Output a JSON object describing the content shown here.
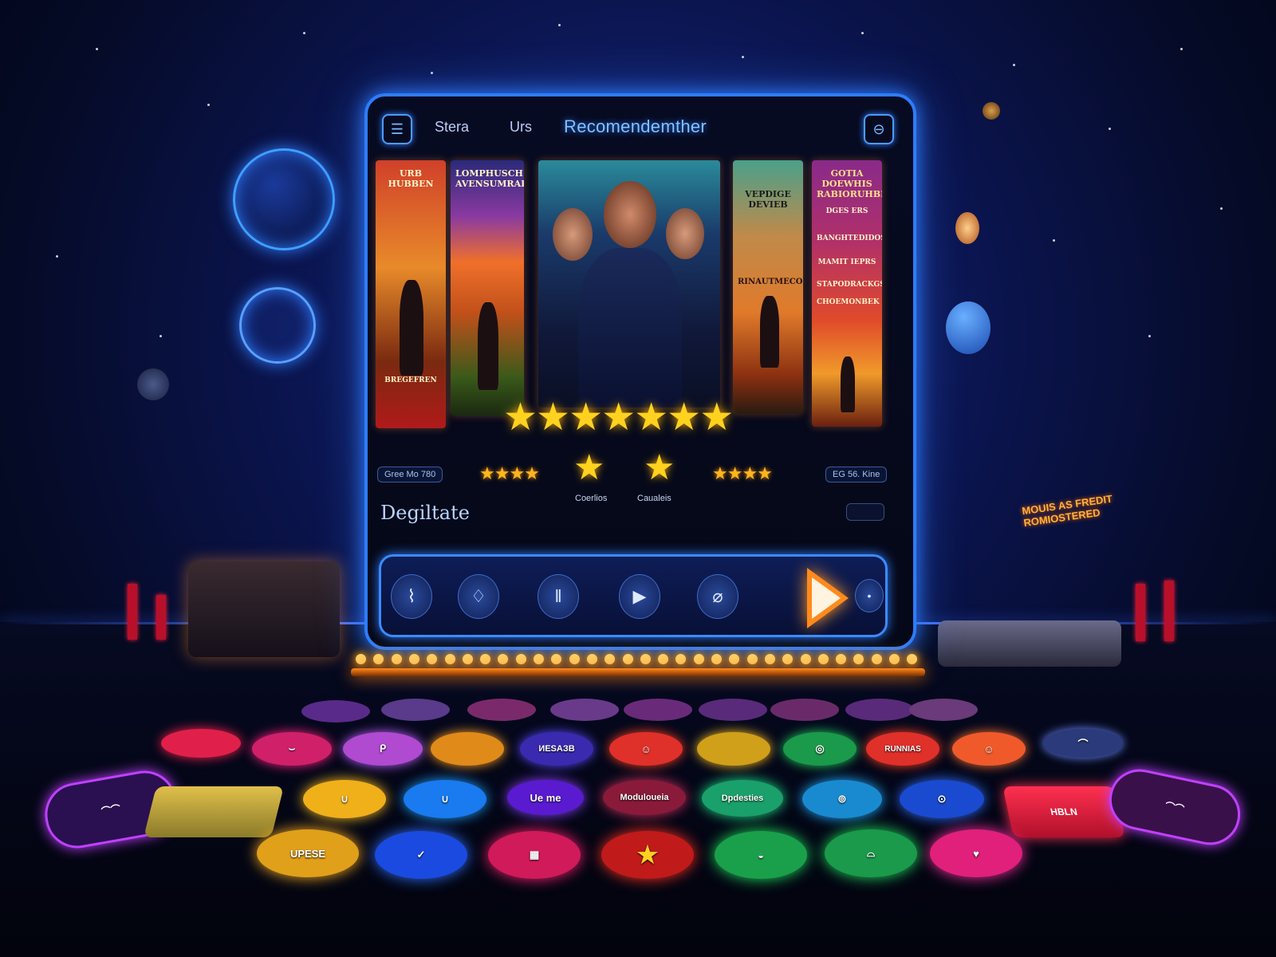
{
  "header": {
    "menu_icon": "menu-icon",
    "tabs": [
      {
        "label": "Stera"
      },
      {
        "label": "Urs"
      },
      {
        "label": "Recomendemther"
      }
    ],
    "profile_icon": "profile-icon"
  },
  "posters": [
    {
      "title": "URB HUBBEN",
      "footer": "BREGEFREN"
    },
    {
      "title": "LOMPHUSCH AVENSUMRAPION"
    },
    {
      "title": ""
    },
    {
      "title": "VEPDIGE DEVIEB",
      "footer": "RINAUTMECON"
    },
    {
      "title": "GOTIA DOEWHIS RABIORUHBBIHS",
      "lines": [
        "DGES ERS",
        "BANGHTEDIDOS",
        "MAMIT IEPRS",
        "STAPODRACKGS",
        "CHOEMONBEK"
      ]
    }
  ],
  "rating": {
    "main_stars": "★★★★★★★",
    "left_chip": "Gree Mo 780",
    "left_stars": "★★★★",
    "center_left_caption": "Coerlios",
    "center_right_caption": "Caualeis",
    "right_stars": "★★★★",
    "right_chip": "EG 56. Kine"
  },
  "section": {
    "title": "Degiltate"
  },
  "player": {
    "buttons": [
      "bookmark-icon",
      "drop-icon",
      "pause-icon",
      "play-icon",
      "microphone-icon",
      "dot-icon"
    ],
    "big_play": "play-icon"
  },
  "billboard": {
    "text": "MOUIS AS FREDIT ROMIOSTERED"
  },
  "discs": {
    "row2": [
      "",
      "",
      "",
      "",
      "ИESAЗB",
      "",
      "",
      "",
      "RUNNIAS",
      "",
      ""
    ],
    "row3": [
      "",
      "",
      "Ue me",
      "Moduloueia",
      "Dpdesties",
      "",
      ""
    ],
    "row4": [
      "UPESE",
      "",
      "",
      "",
      "",
      "",
      ""
    ],
    "card_right": "HBLN"
  },
  "colors": {
    "accent_blue": "#2d7dff",
    "star_gold": "#ffd21f",
    "play_orange": "#ff8a1c"
  }
}
